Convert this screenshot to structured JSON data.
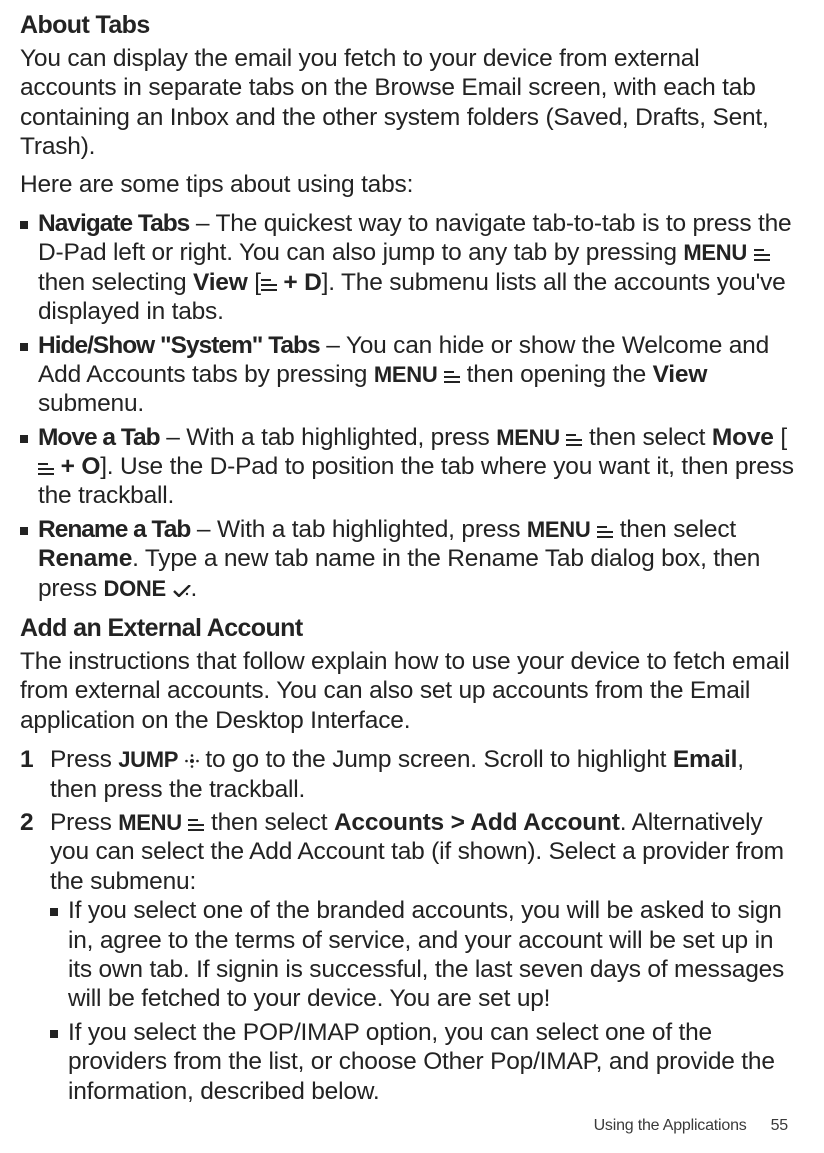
{
  "sections": {
    "about_tabs": {
      "heading": "About Tabs",
      "intro": "You can display the email you fetch to your device from external accounts in separate tabs on the Browse Email screen, with each tab containing an Inbox and the other system folders (Saved, Drafts, Sent, Trash).",
      "tips_intro": "Here are some tips about using tabs:",
      "items": [
        {
          "title": "Navigate Tabs",
          "dash": " – ",
          "a": "The quickest way to navigate tab-to-tab is to press the D-Pad left or right. You can also jump to any tab by pressing ",
          "menu": "MENU",
          "b": " then selecting ",
          "view": "View",
          "c": " [",
          "shortcut": " + D",
          "d": "]. The submenu lists all the accounts you've displayed in tabs."
        },
        {
          "title": "Hide/Show \"System\" Tabs",
          "dash": " – ",
          "a": "You can hide or show the Welcome and Add Accounts tabs by pressing ",
          "menu": "MENU",
          "b": " then opening the ",
          "view": "View",
          "c": " submenu."
        },
        {
          "title": "Move a Tab",
          "dash": " – ",
          "a": "With a tab highlighted, press ",
          "menu": "MENU",
          "b": " then select ",
          "move": "Move",
          "c": " [",
          "shortcut": " + O",
          "d": "]. Use the D-Pad to position the tab where you want it, then press the trackball."
        },
        {
          "title": "Rename a Tab",
          "dash": " – ",
          "a": "With a tab highlighted, press ",
          "menu": "MENU",
          "b": " then select ",
          "rename": "Rename",
          "c": ". Type a new tab name in the Rename Tab dialog box, then press ",
          "done": "DONE",
          "d": "."
        }
      ]
    },
    "add_account": {
      "heading": "Add an External Account",
      "intro": "The instructions that follow explain how to use your device to fetch email from external accounts. You can also set up accounts from the Email application on the Desktop Interface.",
      "steps": [
        {
          "num": "1",
          "a": "Press ",
          "jump": "JUMP",
          "b": " to go to the Jump screen. Scroll to highlight ",
          "email": "Email",
          "c": ", then press the trackball."
        },
        {
          "num": "2",
          "a": "Press ",
          "menu": "MENU",
          "b": "  then select ",
          "accounts": "Accounts > Add Account",
          "c": ". Alternatively you can select the Add Account tab (if shown). Select a provider from the submenu:",
          "subs": [
            "If you select one of the branded accounts, you will be asked to sign in, agree to the terms of service, and your account will be set up in its own tab. If signin is successful, the last seven days of messages will be fetched to your device. You are set up!",
            "If you select the POP/IMAP option, you can select one of the providers from the list, or choose Other Pop/IMAP, and provide the information, described below."
          ]
        }
      ]
    }
  },
  "footer": {
    "section": "Using the Applications",
    "page": "55"
  }
}
